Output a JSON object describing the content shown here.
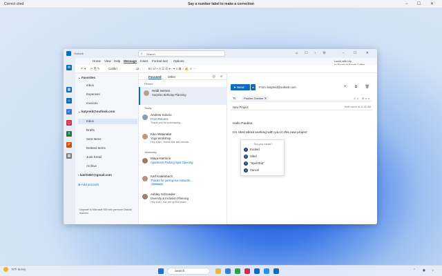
{
  "top_bar": {
    "left": "Correct cited",
    "center": "Say a number label to make a correction",
    "controls": "− ☐ ✕"
  },
  "window": {
    "app_title": "Outlook",
    "search_placeholder": "Search",
    "controls": "− ☐ ✕"
  },
  "ribbon_tabs": [
    "Home",
    "View",
    "Help",
    "Message",
    "Insert",
    "Format text",
    "Options"
  ],
  "ribbon": {
    "font": "Calibri",
    "size": "11"
  },
  "calendar_peek": {
    "line1": "Lunch with Lily",
    "line2": "In 30 min at Fourth Coffee"
  },
  "folders": {
    "favorites_label": "Favorites",
    "favorites": [
      "Inbox",
      "Expenses",
      "Invoices"
    ],
    "account1": "katyreid@outlook.com",
    "account1_folders": [
      "Inbox",
      "Drafts",
      "Sent Items",
      "Deleted Items",
      "Junk Email",
      "Archive"
    ],
    "account2": "katri0487@gmail.com",
    "add_account": "Add account",
    "promo": "Upgrade to Microsoft 365 with premium Outlook features"
  },
  "message_list": {
    "tabs": [
      "Focused",
      "Other"
    ],
    "groups": {
      "pinned": "Pinned",
      "today": "Today",
      "yesterday": "Yesterday"
    },
    "messages": [
      {
        "sender": "Heidi Iversen",
        "subject": "Surprise Birthday Planning",
        "preview": ""
      },
      {
        "sender": "Andrew Solorio",
        "subject": "From Returns",
        "preview": "Thank you for purchasing..."
      },
      {
        "sender": "Kiko Watanabe",
        "subject": "Yoga Workshop",
        "preview": "Hey Katri, I know this last minute..."
      },
      {
        "sender": "Maya Harrison",
        "subject": "Apartment Parking Spot Opening",
        "preview": ""
      },
      {
        "sender": "Karl Kadenbach",
        "subject": "Thanks for joining our networki...",
        "preview": "Outreach"
      },
      {
        "sender": "Ashley Schroeder",
        "subject": "Diversity & Inclusion Planning",
        "preview": "Hey Katri, I've set up this team..."
      }
    ]
  },
  "compose": {
    "send": "Send",
    "from": "From: katyreid@outlook.com",
    "to_label": "To",
    "to_recipient": "Pauline Zweiber",
    "cc_bcc": "Cc Bcc",
    "subject": "New Project",
    "draft_status": "Draft saved at 11:05 AM",
    "body_greeting": "Hello Pauline,",
    "body_text": "I'm cited about working with you in this new project",
    "popup_title": "Did you mean?",
    "suggestions": [
      {
        "num": "1",
        "text": "Excited"
      },
      {
        "num": "2",
        "text": "Sited"
      },
      {
        "num": "3",
        "text": "\"Spell that\""
      },
      {
        "num": "4",
        "text": "Cancel"
      }
    ]
  },
  "taskbar": {
    "temp": "78°F",
    "condition": "Sunny",
    "search": "Search"
  }
}
